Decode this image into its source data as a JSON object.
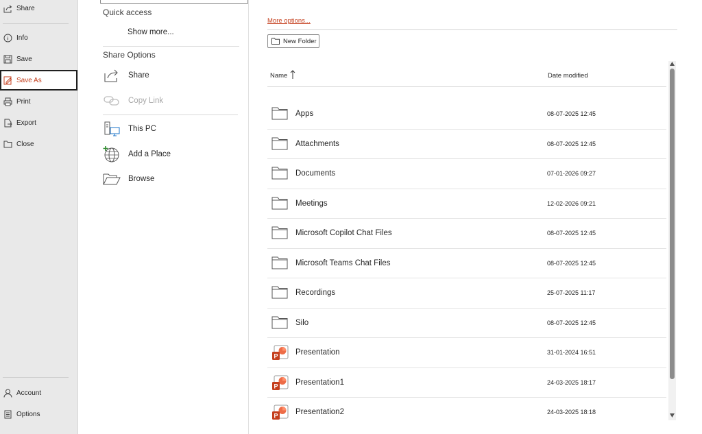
{
  "nav": {
    "items": [
      {
        "label": "Share",
        "icon": "share-icon"
      },
      {
        "label": "Info",
        "icon": "info-icon"
      },
      {
        "label": "Save",
        "icon": "save-icon"
      },
      {
        "label": "Save As",
        "icon": "save-as-icon",
        "active": true
      },
      {
        "label": "Print",
        "icon": "print-icon"
      },
      {
        "label": "Export",
        "icon": "export-icon"
      },
      {
        "label": "Close",
        "icon": "close-icon"
      }
    ],
    "bottom": [
      {
        "label": "Account",
        "icon": "person-icon"
      },
      {
        "label": "Options",
        "icon": "options-icon"
      }
    ]
  },
  "middle": {
    "quick_access": "Quick access",
    "show_more": "Show more...",
    "share_options": "Share Options",
    "share": "Share",
    "copy_link": "Copy Link",
    "this_pc": "This PC",
    "add_place": "Add a Place",
    "browse": "Browse"
  },
  "right": {
    "more_options": "More options...",
    "new_folder": "New Folder",
    "columns": {
      "name": "Name",
      "date": "Date modified"
    },
    "files": [
      {
        "name": "Apps",
        "date": "08-07-2025 12:45",
        "type": "folder"
      },
      {
        "name": "Attachments",
        "date": "08-07-2025 12:45",
        "type": "folder"
      },
      {
        "name": "Documents",
        "date": "07-01-2026 09:27",
        "type": "folder"
      },
      {
        "name": "Meetings",
        "date": "12-02-2026 09:21",
        "type": "folder"
      },
      {
        "name": "Microsoft Copilot Chat Files",
        "date": "08-07-2025 12:45",
        "type": "folder"
      },
      {
        "name": "Microsoft Teams Chat Files",
        "date": "08-07-2025 12:45",
        "type": "folder"
      },
      {
        "name": "Recordings",
        "date": "25-07-2025 11:17",
        "type": "folder"
      },
      {
        "name": "Silo",
        "date": "08-07-2025 12:45",
        "type": "folder"
      },
      {
        "name": "Presentation",
        "date": "31-01-2024 16:51",
        "type": "pptx"
      },
      {
        "name": "Presentation1",
        "date": "24-03-2025 18:17",
        "type": "pptx"
      },
      {
        "name": "Presentation2",
        "date": "24-03-2025 18:18",
        "type": "pptx"
      }
    ]
  },
  "colors": {
    "accent": "#c43e1c",
    "nav_bg": "#e9e9e9",
    "ppt_red": "#c43e1c"
  }
}
